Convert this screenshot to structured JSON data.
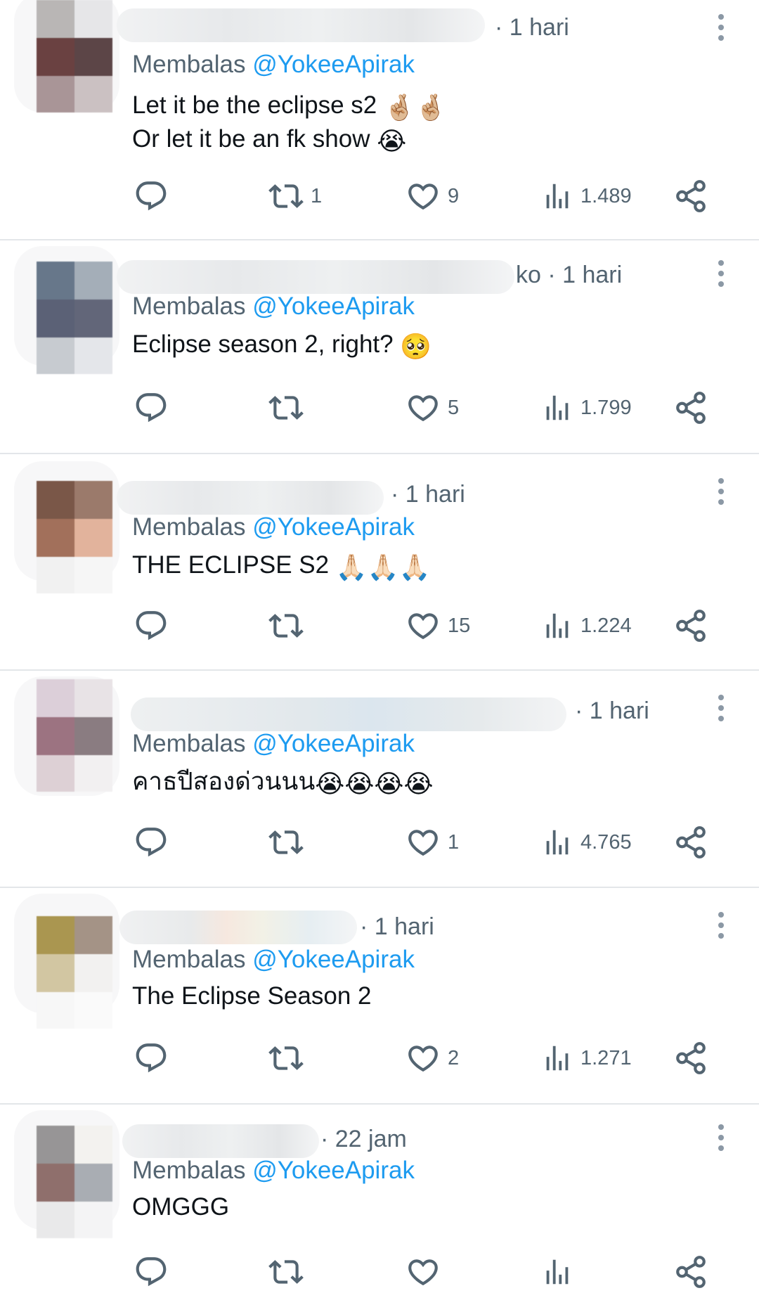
{
  "colors": {
    "text": "#0f1419",
    "secondary": "#536471",
    "link": "#1d9bf0",
    "divider": "#e3e6e9"
  },
  "replies": [
    {
      "time": "· 1 hari",
      "replying_prefix": "Membalas",
      "replying_handle": "@YokeeApirak",
      "text_lines": [
        "Let it be the eclipse s2",
        "Or let it be an fk show"
      ],
      "emoji_lines": [
        "🤞🏼🤞🏼",
        "😭"
      ],
      "retweets": "1",
      "likes": "9",
      "views": "1.489"
    },
    {
      "time": "ko · 1 hari",
      "replying_prefix": "Membalas",
      "replying_handle": "@YokeeApirak",
      "text_lines": [
        "Eclipse season 2, right?"
      ],
      "emoji_lines": [
        "🥺"
      ],
      "retweets": "",
      "likes": "5",
      "views": "1.799"
    },
    {
      "time": "· 1 hari",
      "replying_prefix": "Membalas",
      "replying_handle": "@YokeeApirak",
      "text_lines": [
        "THE ECLIPSE S2"
      ],
      "emoji_lines": [
        "🙏🏻🙏🏻🙏🏻"
      ],
      "retweets": "",
      "likes": "15",
      "views": "1.224"
    },
    {
      "time": "· 1 hari",
      "replying_prefix": "Membalas",
      "replying_handle": "@YokeeApirak",
      "text_lines": [
        "คาธปีสองด่วนนน"
      ],
      "emoji_lines": [
        "😭😭😭😭"
      ],
      "retweets": "",
      "likes": "1",
      "views": "4.765"
    },
    {
      "time": "· 1 hari",
      "replying_prefix": "Membalas",
      "replying_handle": "@YokeeApirak",
      "text_lines": [
        "The Eclipse Season 2"
      ],
      "emoji_lines": [
        ""
      ],
      "retweets": "",
      "likes": "2",
      "views": "1.271"
    },
    {
      "time": "· 22 jam",
      "replying_prefix": "Membalas",
      "replying_handle": "@YokeeApirak",
      "text_lines": [
        "OMGGG"
      ],
      "emoji_lines": [
        ""
      ],
      "retweets": "",
      "likes": "",
      "views": ""
    }
  ]
}
